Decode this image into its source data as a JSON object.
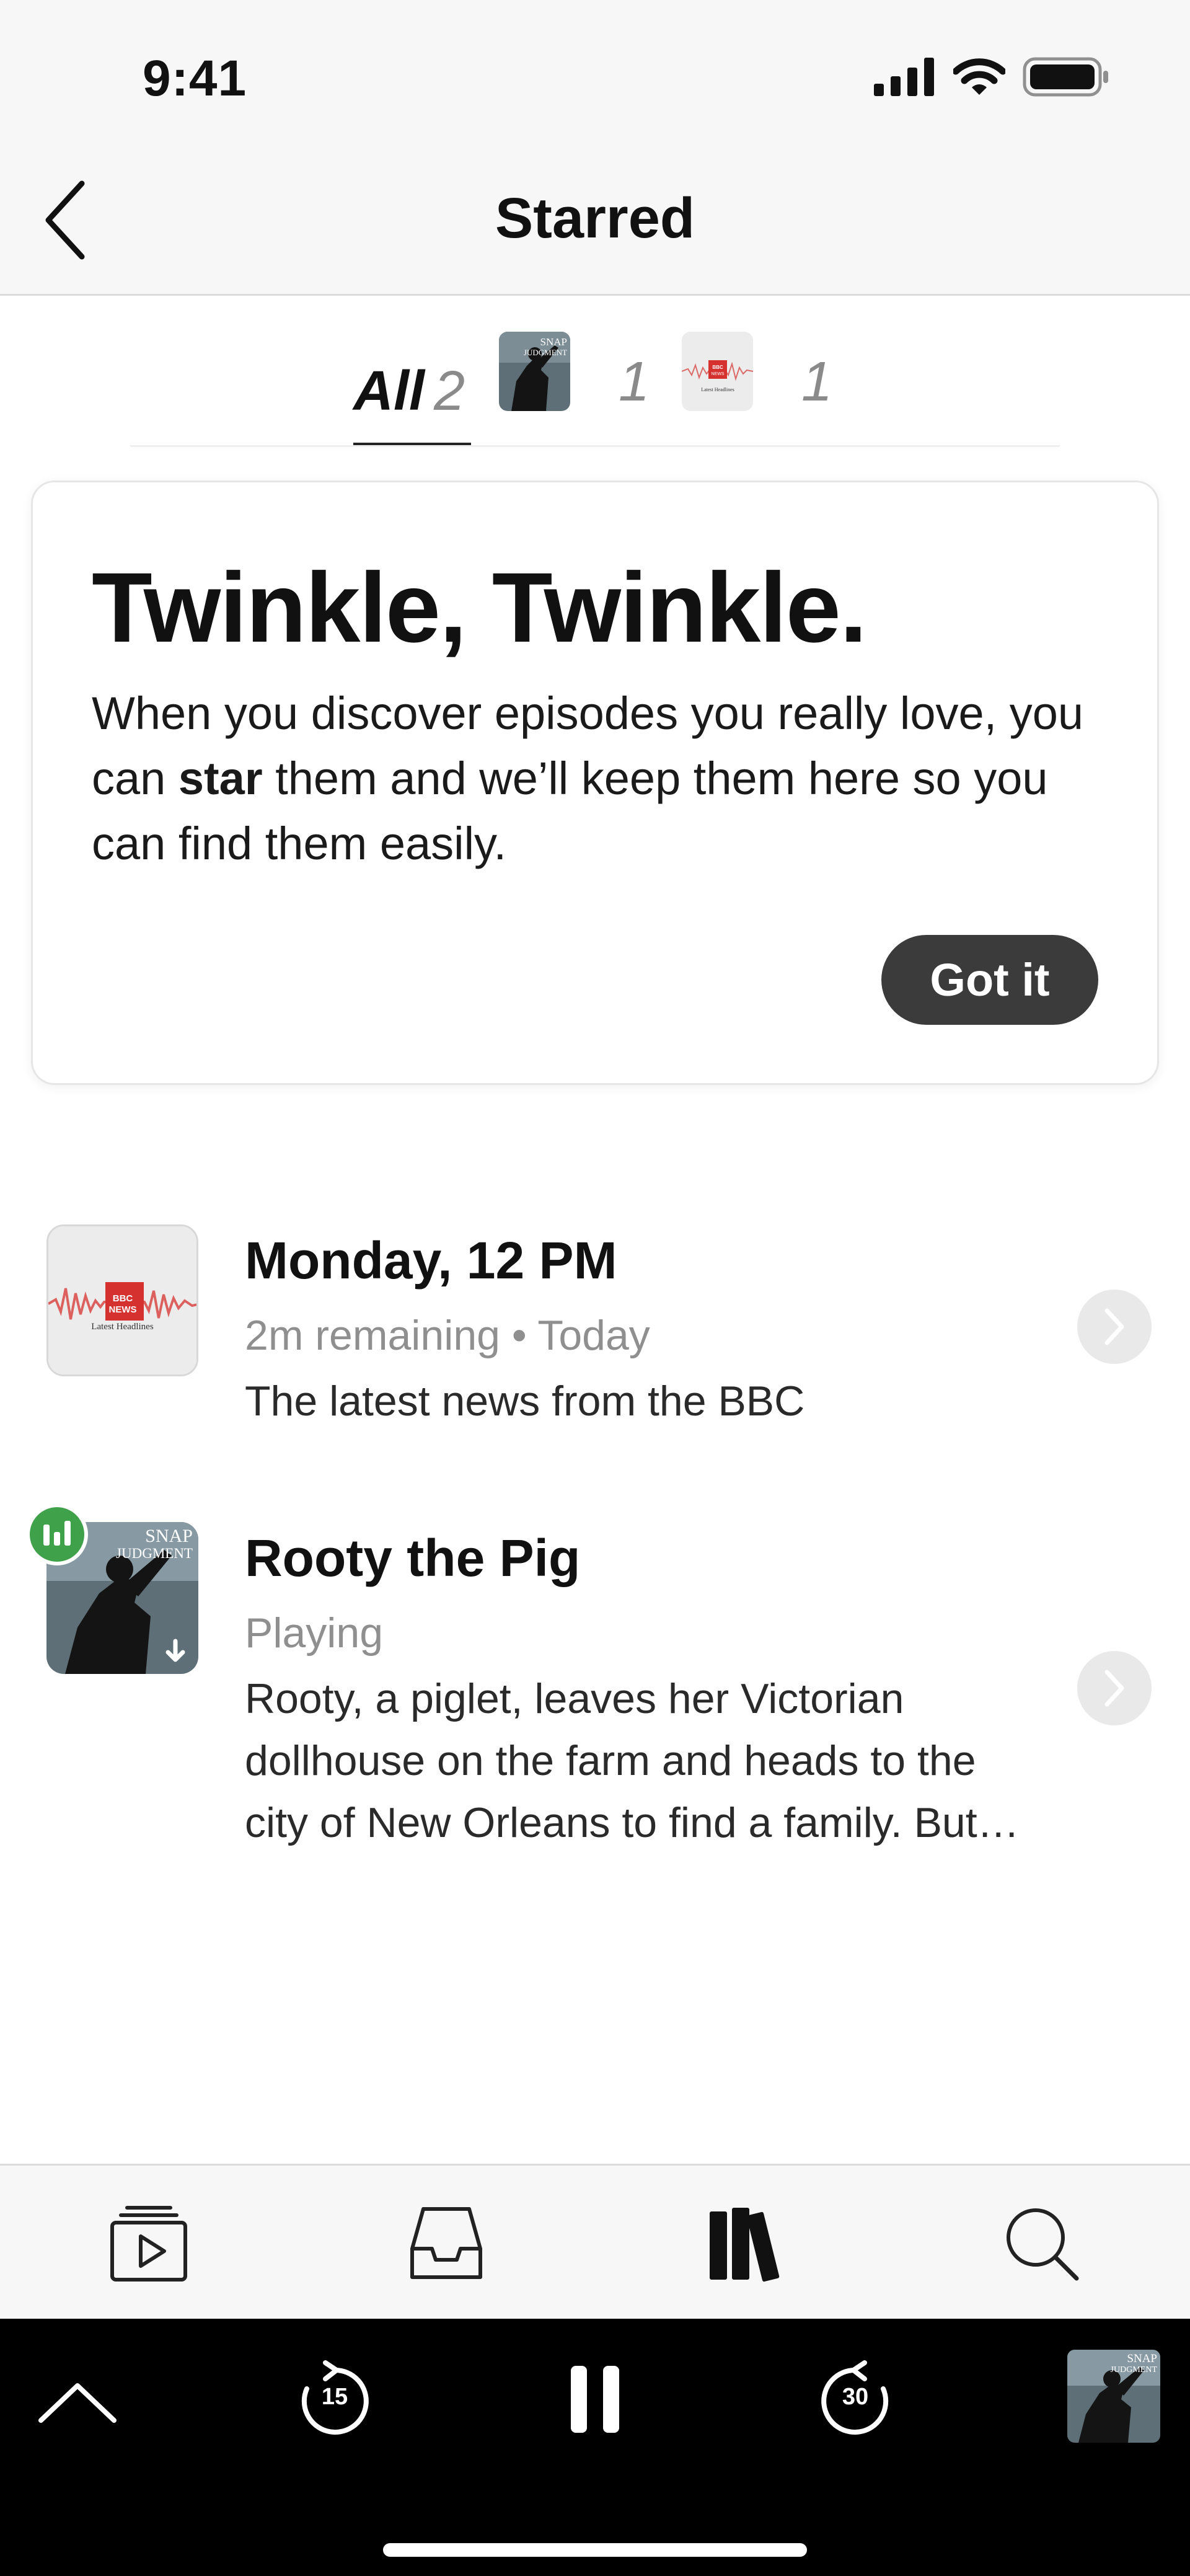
{
  "status_bar": {
    "time": "9:41"
  },
  "nav": {
    "title": "Starred",
    "back_icon": "chevron-left-icon"
  },
  "filter_tabs": {
    "all_label": "All",
    "all_count": "2",
    "podcasts": [
      {
        "name": "Snap Judgment",
        "count": "1"
      },
      {
        "name": "BBC News Latest Headlines",
        "count": "1"
      }
    ]
  },
  "card": {
    "title": "Twinkle, Twinkle.",
    "body_before": "When you discover episodes you really love, you can ",
    "body_bold": "star",
    "body_after": " them and we’ll keep them here so you can find them easily.",
    "button": "Got it"
  },
  "episodes": [
    {
      "title": "Monday, 12 PM",
      "meta": "2m remaining • Today",
      "description": "The latest news from the BBC",
      "art": {
        "brand": "BBC",
        "sub": "NEWS",
        "caption": "Latest Headlines",
        "accent": "#d5322f"
      }
    },
    {
      "title": "Rooty the Pig",
      "meta": "Playing",
      "description": "Rooty, a piglet, leaves her Victorian dollhouse on the farm and heads to the city of New Orleans to find a family. But…",
      "art": {
        "line1": "SNAP",
        "line2": "JUDGMENT"
      },
      "playing": true,
      "downloaded": true
    }
  ],
  "tab_bar": [
    "now-playing-icon",
    "inbox-icon",
    "library-icon",
    "search-icon"
  ],
  "player": {
    "skip_back": "15",
    "skip_forward": "30"
  },
  "colors": {
    "accent_green": "#3fa14a",
    "button_dark": "#3b3b3b",
    "bbc_red": "#d5322f"
  }
}
